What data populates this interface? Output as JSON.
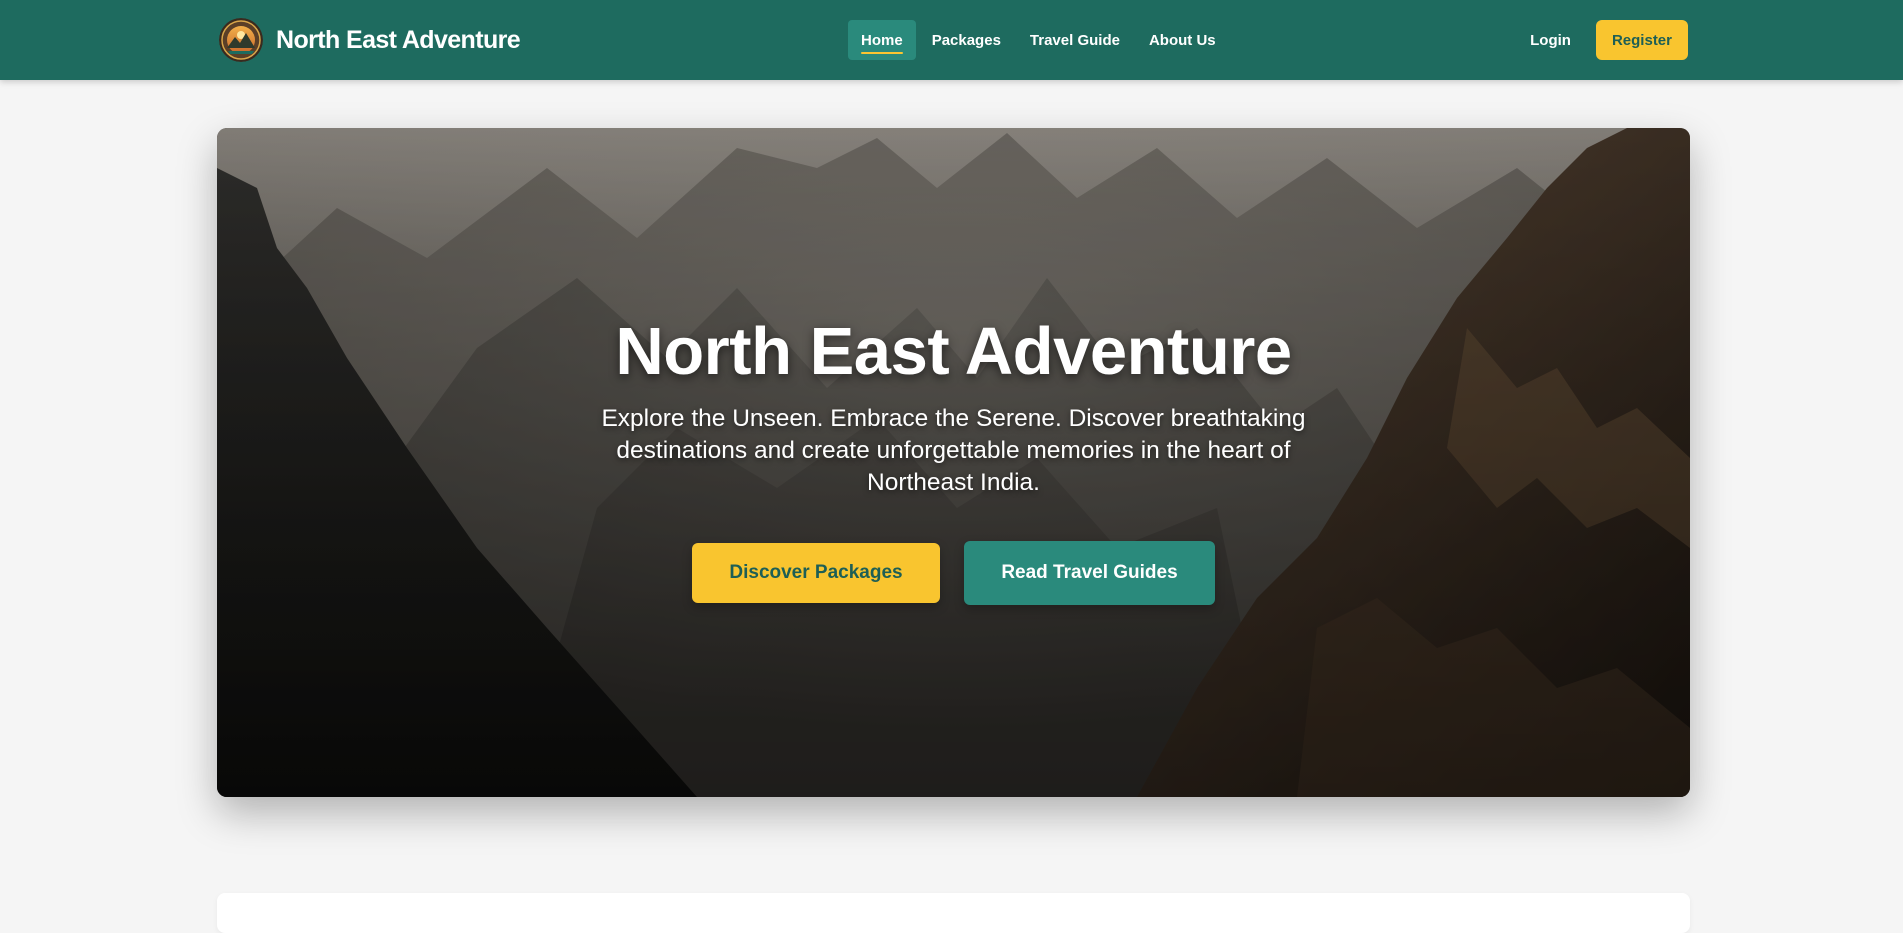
{
  "brand": {
    "name": "North East Adventure",
    "logo_icon": "mountain-emblem-logo"
  },
  "nav": {
    "links": [
      {
        "label": "Home",
        "active": true
      },
      {
        "label": "Packages",
        "active": false
      },
      {
        "label": "Travel Guide",
        "active": false
      },
      {
        "label": "About Us",
        "active": false
      }
    ],
    "login_label": "Login",
    "register_label": "Register"
  },
  "hero": {
    "title": "North East Adventure",
    "subtitle": "Explore the Unseen. Embrace the Serene. Discover breathtaking destinations and create unforgettable memories in the heart of Northeast India.",
    "primary_button": "Discover Packages",
    "secondary_button": "Read Travel Guides"
  },
  "colors": {
    "navbar_bg": "#1e6b5f",
    "accent_yellow": "#f9c52f",
    "teal_button": "#2a8a7c",
    "page_bg": "#f5f5f5"
  }
}
